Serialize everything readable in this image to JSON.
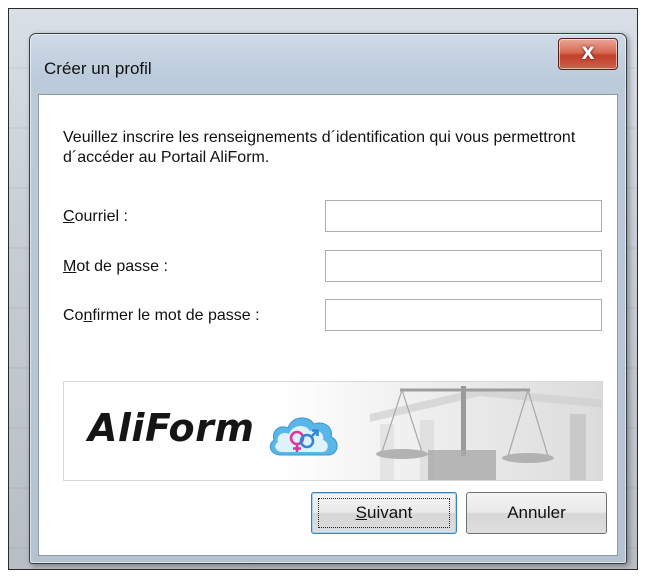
{
  "dialog": {
    "title": "Créer un profil",
    "close_label": "X",
    "intro": "Veuillez inscrire les renseignements d´identification qui vous permettront d´accéder au Portail AliForm.",
    "fields": [
      {
        "label": "Courriel :",
        "mnemonic": "C",
        "value": "",
        "placeholder": ""
      },
      {
        "label": "Mot de passe :",
        "mnemonic": "M",
        "value": "",
        "placeholder": ""
      },
      {
        "label": "Confirmer le mot de passe :",
        "mnemonic": "n",
        "value": "",
        "placeholder": ""
      }
    ],
    "banner": {
      "brand": "AliForm",
      "logo_icon": "gender-symbols-cloud-icon",
      "background_icon": "balance-scales-icon"
    },
    "buttons": {
      "next": "Suivant",
      "cancel": "Annuler"
    }
  },
  "colors": {
    "close_button": "#c1412a",
    "logo_cloud": "#58b6e8",
    "female_symbol": "#e0359a",
    "male_symbol": "#2f86d6"
  }
}
